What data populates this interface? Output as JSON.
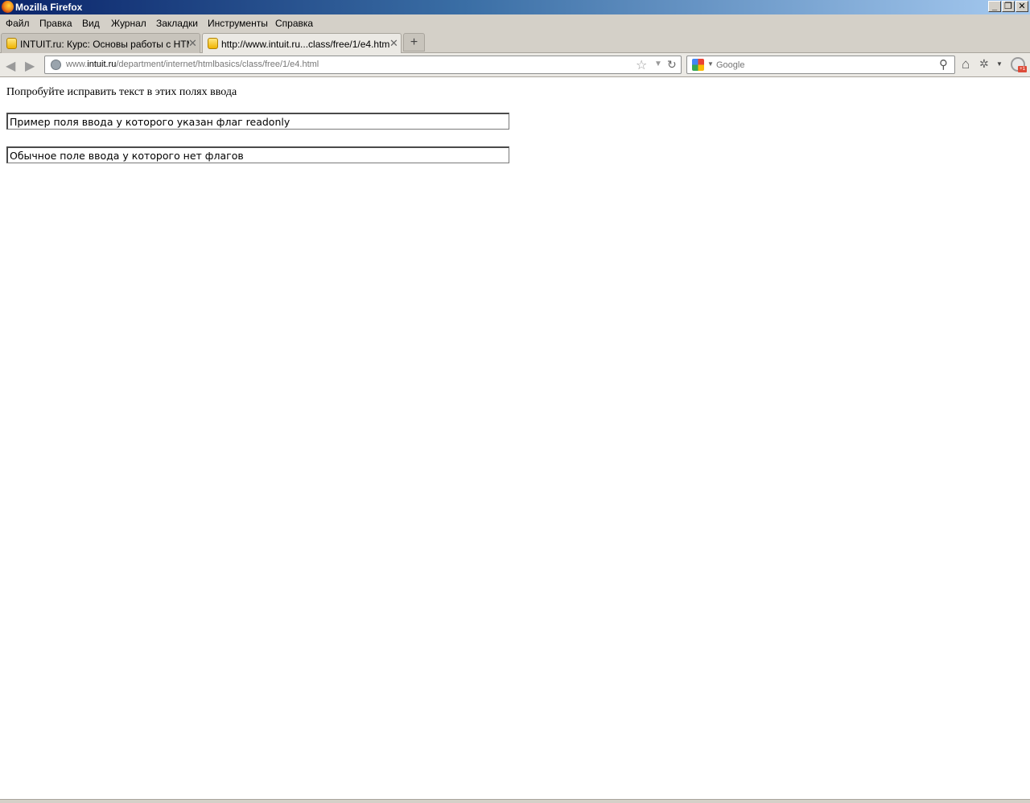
{
  "window": {
    "title": "Mozilla Firefox",
    "controls": {
      "minimize": "_",
      "maximize": "❐",
      "close": "✕"
    }
  },
  "menu": {
    "items": [
      "Файл",
      "Правка",
      "Вид",
      "Журнал",
      "Закладки",
      "Инструменты",
      "Справка"
    ]
  },
  "tabs": [
    {
      "label": "INTUIT.ru: Курс: Основы работы с HTM...",
      "active": false,
      "close": "✕"
    },
    {
      "label": "http://www.intuit.ru...class/free/1/e4.html",
      "active": true,
      "close": "✕"
    }
  ],
  "new_tab": "+",
  "nav": {
    "back": "◀",
    "forward": "▶",
    "url_prefix": "www.",
    "url_host": "intuit.ru",
    "url_path": "/department/internet/htmlbasics/class/free/1/e4.html",
    "bookmark_star": "☆",
    "dropdown": "▼",
    "reload": "↻",
    "search_placeholder": "Google",
    "search_caret": "▼",
    "search_magnifier": "⚲",
    "home": "⌂",
    "addon": "✲",
    "addon_caret": "▼",
    "gplus_badge": "+1"
  },
  "page": {
    "instruction": "Попробуйте исправить текст в этих полях ввода",
    "field_readonly_value": "Пример поля ввода у которого указан флаг readonly",
    "field_normal_value": "Обычное поле ввода у которого нет флагов"
  },
  "colors": {
    "titlebar_start": "#0a246a",
    "titlebar_end": "#a6caf0",
    "chrome": "#d4d0c8"
  }
}
